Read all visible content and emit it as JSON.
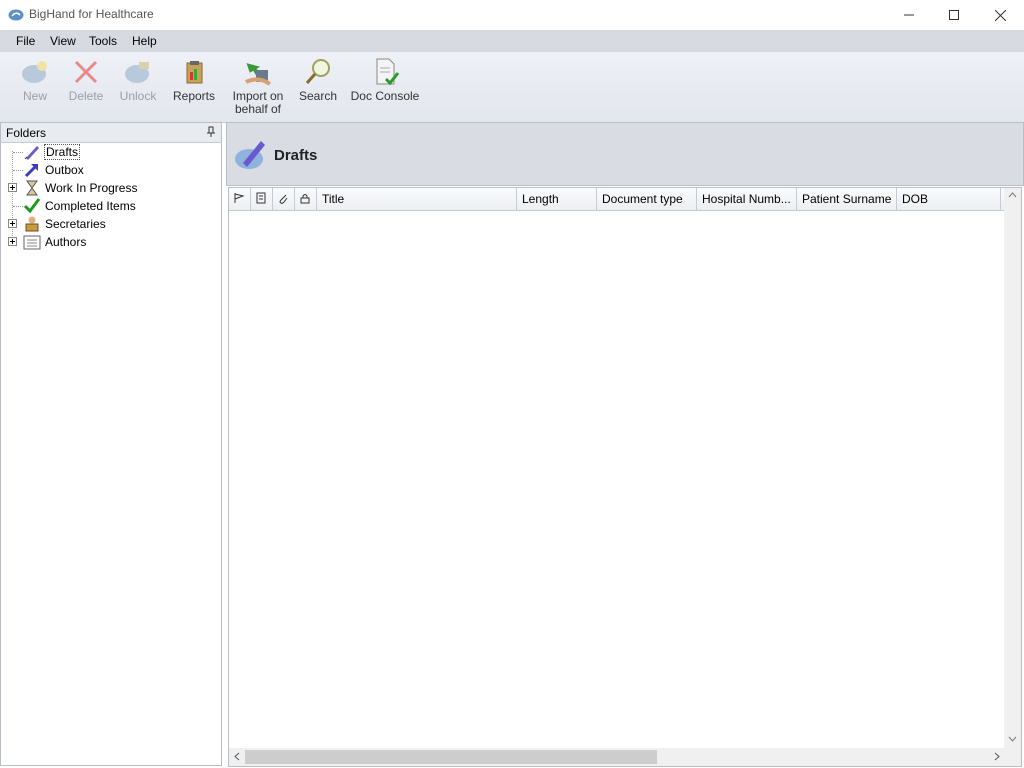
{
  "window": {
    "title": "BigHand for Healthcare"
  },
  "menu": {
    "file": "File",
    "view": "View",
    "tools": "Tools",
    "help": "Help"
  },
  "toolbar": {
    "new": "New",
    "delete": "Delete",
    "unlock": "Unlock",
    "reports": "Reports",
    "import_line1": "Import on",
    "import_line2": "behalf of",
    "search": "Search",
    "doc_console": "Doc Console"
  },
  "folders": {
    "header": "Folders",
    "items": [
      {
        "label": "Drafts",
        "icon": "drafts-pen-icon",
        "expandable": false,
        "selected": true
      },
      {
        "label": "Outbox",
        "icon": "outbox-arrow-icon",
        "expandable": false
      },
      {
        "label": "Work In Progress",
        "icon": "hourglass-icon",
        "expandable": true
      },
      {
        "label": "Completed Items",
        "icon": "checkmark-icon",
        "expandable": false
      },
      {
        "label": "Secretaries",
        "icon": "secretaries-icon",
        "expandable": true
      },
      {
        "label": "Authors",
        "icon": "authors-list-icon",
        "expandable": true
      }
    ]
  },
  "main": {
    "title": "Drafts",
    "columns": [
      "Title",
      "Length",
      "Document type",
      "Hospital Numb...",
      "Patient Surname",
      "DOB"
    ]
  }
}
